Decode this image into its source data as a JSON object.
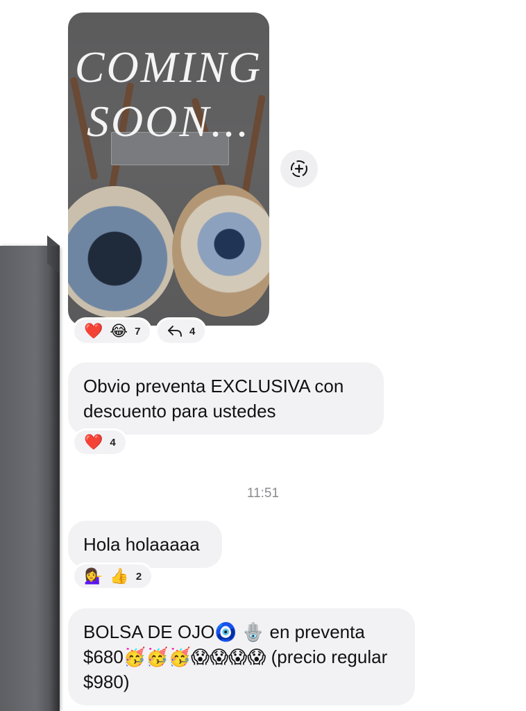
{
  "story": {
    "title_line1": "COMING",
    "title_line2": "SOON...",
    "reactions": {
      "emoji1": "❤️",
      "emoji2": "😂",
      "count": "7"
    },
    "replies": {
      "count": "4"
    }
  },
  "share_button": {
    "icon": "add-circle-icon"
  },
  "messages": [
    {
      "text": "Obvio preventa EXCLUSIVA con descuento para ustedes",
      "reactions": {
        "emoji1": "❤️",
        "count": "4"
      }
    },
    {
      "text": "Hola holaaaaa",
      "reactions": {
        "emoji1": "💁‍♀️",
        "emoji2": "👍",
        "count": "2"
      }
    },
    {
      "text": "BOLSA DE OJO🧿 🪬 en preventa $680🥳🥳🥳😱😱😱😱  (precio regular $980)"
    }
  ],
  "timestamp": "11:51"
}
